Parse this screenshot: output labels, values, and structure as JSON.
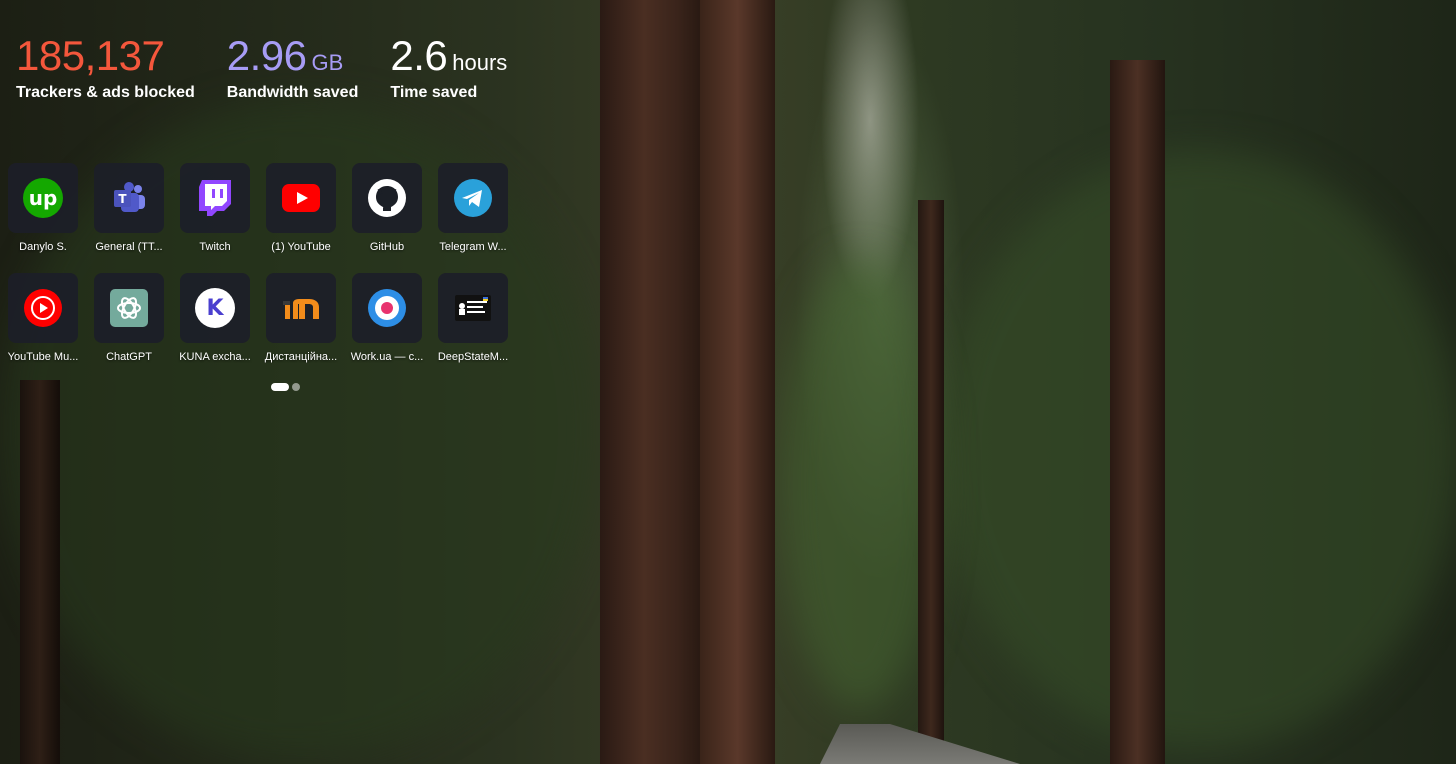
{
  "stats": [
    {
      "value": "185,137",
      "unit": "",
      "label": "Trackers & ads blocked",
      "color": "#f4573c"
    },
    {
      "value": "2.96",
      "unit": "GB",
      "label": "Bandwidth saved",
      "color": "#a79cf5"
    },
    {
      "value": "2.6",
      "unit": "hours",
      "label": "Time saved",
      "color": "#ffffff"
    }
  ],
  "tiles": [
    [
      {
        "label": "Danylo S.",
        "icon": "upwork-icon"
      },
      {
        "label": "General (TT...",
        "icon": "teams-icon"
      },
      {
        "label": "Twitch",
        "icon": "twitch-icon"
      },
      {
        "label": "(1) YouTube",
        "icon": "youtube-icon"
      },
      {
        "label": "GitHub",
        "icon": "github-icon"
      },
      {
        "label": "Telegram W...",
        "icon": "telegram-icon"
      }
    ],
    [
      {
        "label": "YouTube Mu...",
        "icon": "youtube-music-icon"
      },
      {
        "label": "ChatGPT",
        "icon": "chatgpt-icon"
      },
      {
        "label": "KUNA excha...",
        "icon": "kuna-icon"
      },
      {
        "label": "Дистанційна...",
        "icon": "distance-learning-icon"
      },
      {
        "label": "Work.ua — с...",
        "icon": "workua-icon"
      },
      {
        "label": "DeepStateM...",
        "icon": "deepstate-icon"
      }
    ]
  ],
  "pager": {
    "pages": 2,
    "current": 1
  }
}
